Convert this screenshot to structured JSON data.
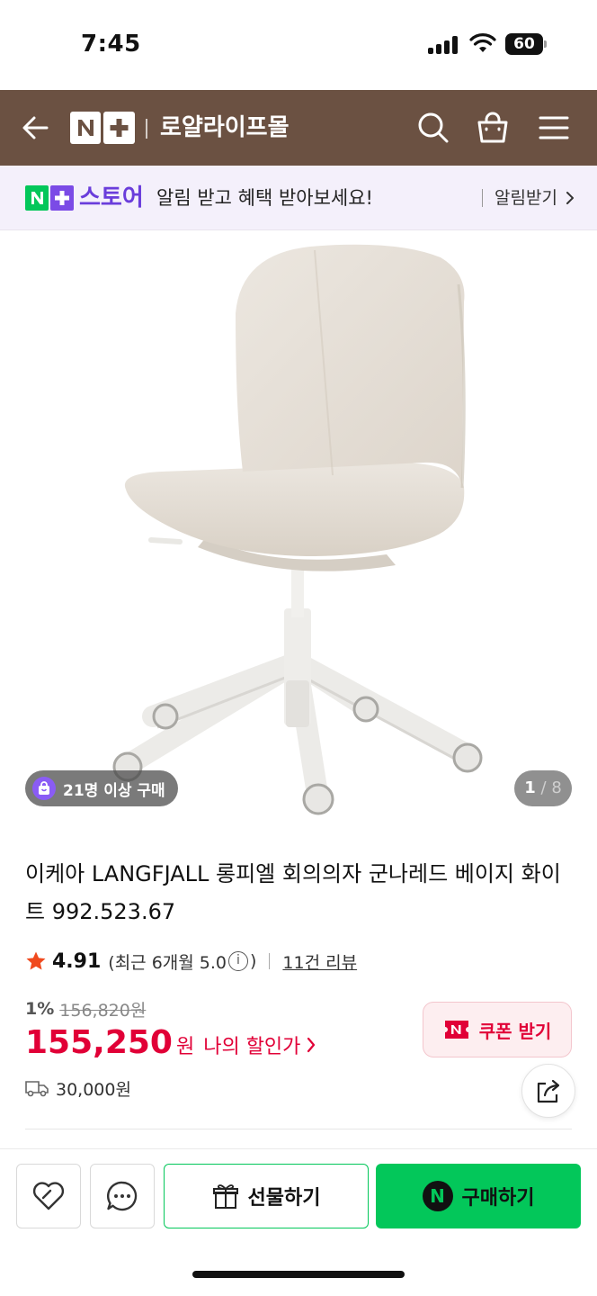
{
  "status_bar": {
    "time": "7:45",
    "battery": "60"
  },
  "header": {
    "logo_text": "N+",
    "title": "로얄라이프몰",
    "bg_color": "#6b5142"
  },
  "store_banner": {
    "brand": "스토어",
    "logo_text": "N+",
    "message": "알림 받고 혜택 받아보세요!",
    "link": "알림받기",
    "brand_color": "#6a3ddb"
  },
  "gallery": {
    "buyers_badge": "21명 이상 구매",
    "current_page": "1",
    "separator": "/",
    "total_pages": "8"
  },
  "product": {
    "title": "이케아 LANGFJALL 롱피엘 회의의자 군나레드 베이지 화이트 992.523.67",
    "rating": "4.91",
    "rating_detail_prefix": "(최근 6개월 5.0",
    "rating_detail_suffix": ")",
    "review_link": "11건 리뷰",
    "discount_rate": "1%",
    "original_price": "156,820원",
    "sale_price": "155,250",
    "sale_currency": "원",
    "my_discount_label": "나의 할인가",
    "coupon_label": "쿠폰 받기",
    "shipping_fee": "30,000원",
    "price_color": "#e10037"
  },
  "bottom_bar": {
    "gift_label": "선물하기",
    "buy_label": "구매하기",
    "buy_color": "#03c75a"
  },
  "icons": [
    "back-arrow-icon",
    "search-icon",
    "cart-icon",
    "menu-icon",
    "chevron-right-icon",
    "shopping-bag-icon",
    "star-icon",
    "info-icon",
    "coupon-icon",
    "truck-icon",
    "share-icon",
    "heart-icon",
    "chat-icon",
    "gift-icon"
  ]
}
